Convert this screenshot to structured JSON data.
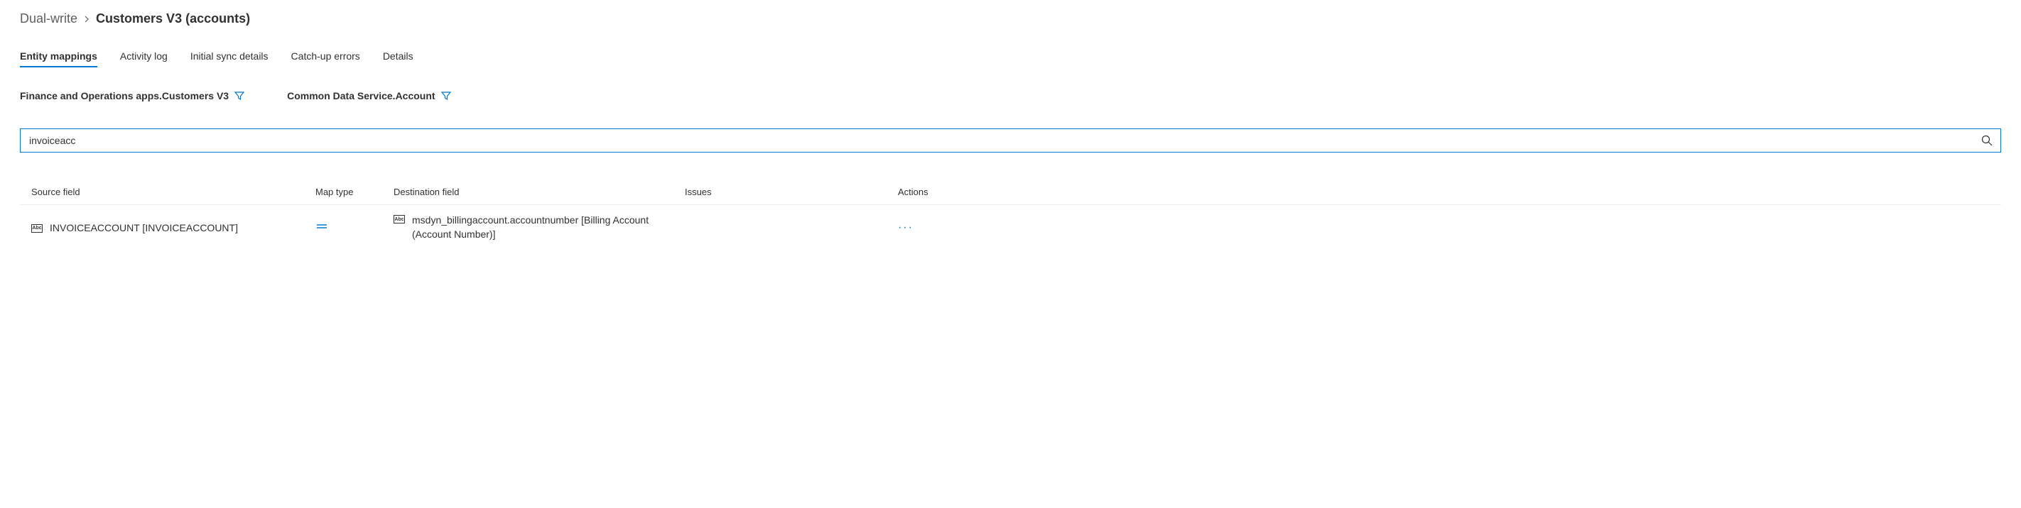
{
  "breadcrumb": {
    "parent": "Dual-write",
    "current": "Customers V3 (accounts)"
  },
  "tabs": [
    {
      "label": "Entity mappings",
      "active": true
    },
    {
      "label": "Activity log",
      "active": false
    },
    {
      "label": "Initial sync details",
      "active": false
    },
    {
      "label": "Catch-up errors",
      "active": false
    },
    {
      "label": "Details",
      "active": false
    }
  ],
  "filters": {
    "source": "Finance and Operations apps.Customers V3",
    "destination": "Common Data Service.Account"
  },
  "search": {
    "value": "invoiceacc"
  },
  "table": {
    "headers": {
      "source": "Source field",
      "maptype": "Map type",
      "destination": "Destination field",
      "issues": "Issues",
      "actions": "Actions"
    },
    "rows": [
      {
        "field_type_label": "Abc",
        "source": "INVOICEACCOUNT [INVOICEACCOUNT]",
        "destination": "msdyn_billingaccount.accountnumber [Billing Account (Account Number)]",
        "issues": ""
      }
    ]
  }
}
